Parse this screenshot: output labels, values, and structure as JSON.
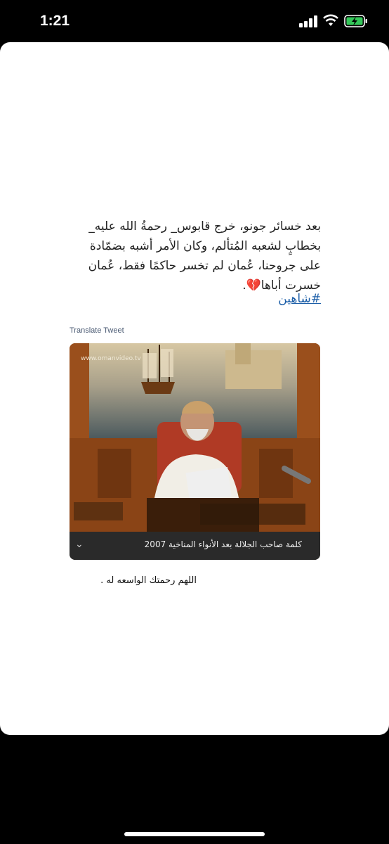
{
  "status": {
    "time": "1:21"
  },
  "tweet": {
    "lines": [
      "بعد خسائر جونو، خرج قابوس_ رحمةُ الله عليه_",
      "بخطابٍ لشعبه المُتألم، وكان الأمر أشبه بضمّادة",
      "على جروحنا، عُمان لم تخسر حاكمًا فقط، عُمان",
      "خسرت أباها💔."
    ],
    "hashtag": "#شاهين",
    "translate_label": "Translate Tweet",
    "video_caption": "كلمة صاحب الجلالة بعد الأنواء المناخية 2007",
    "caption_icon": "chevron-down-icon",
    "watermark": "www.omanvideo.tv"
  },
  "post_caption": "اللهم رحمتك الواسعه له .",
  "colors": {
    "card_bg": "#ffffff",
    "hashtag": "#1d5fa8",
    "caption_bar": "#2a2a2a"
  }
}
